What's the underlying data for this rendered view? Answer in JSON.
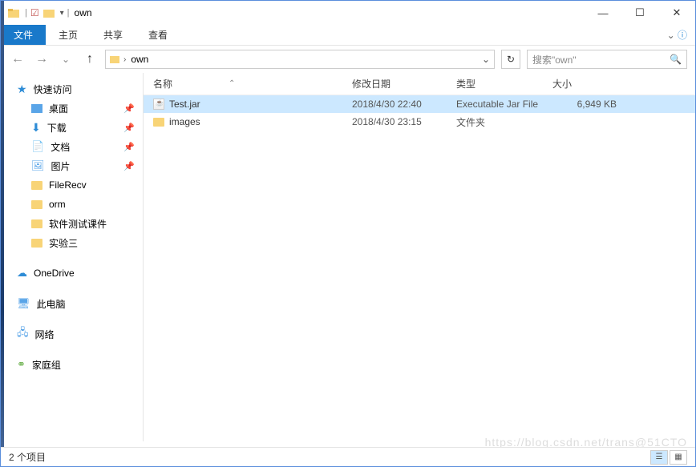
{
  "window": {
    "title": "own"
  },
  "ribbon": {
    "file": "文件",
    "tabs": [
      "主页",
      "共享",
      "查看"
    ]
  },
  "address": {
    "crumb": "own",
    "search_placeholder": "搜索\"own\""
  },
  "sidebar": {
    "quick_access": "快速访问",
    "items": [
      {
        "label": "桌面",
        "pinned": true,
        "icon": "desktop"
      },
      {
        "label": "下载",
        "pinned": true,
        "icon": "download"
      },
      {
        "label": "文档",
        "pinned": true,
        "icon": "document"
      },
      {
        "label": "图片",
        "pinned": true,
        "icon": "picture"
      },
      {
        "label": "FileRecv",
        "pinned": false,
        "icon": "folder"
      },
      {
        "label": "orm",
        "pinned": false,
        "icon": "folder"
      },
      {
        "label": "软件测试课件",
        "pinned": false,
        "icon": "folder"
      },
      {
        "label": "实验三",
        "pinned": false,
        "icon": "folder"
      }
    ],
    "onedrive": "OneDrive",
    "this_pc": "此电脑",
    "network": "网络",
    "homegroup": "家庭组"
  },
  "columns": {
    "name": "名称",
    "date": "修改日期",
    "type": "类型",
    "size": "大小"
  },
  "files": [
    {
      "name": "Test.jar",
      "date": "2018/4/30 22:40",
      "type": "Executable Jar File",
      "size": "6,949 KB",
      "icon": "jar",
      "selected": true
    },
    {
      "name": "images",
      "date": "2018/4/30 23:15",
      "type": "文件夹",
      "size": "",
      "icon": "folder",
      "selected": false
    }
  ],
  "status": {
    "count": "2 个项目"
  },
  "watermark": "https://blog.csdn.net/trans@51CTO"
}
